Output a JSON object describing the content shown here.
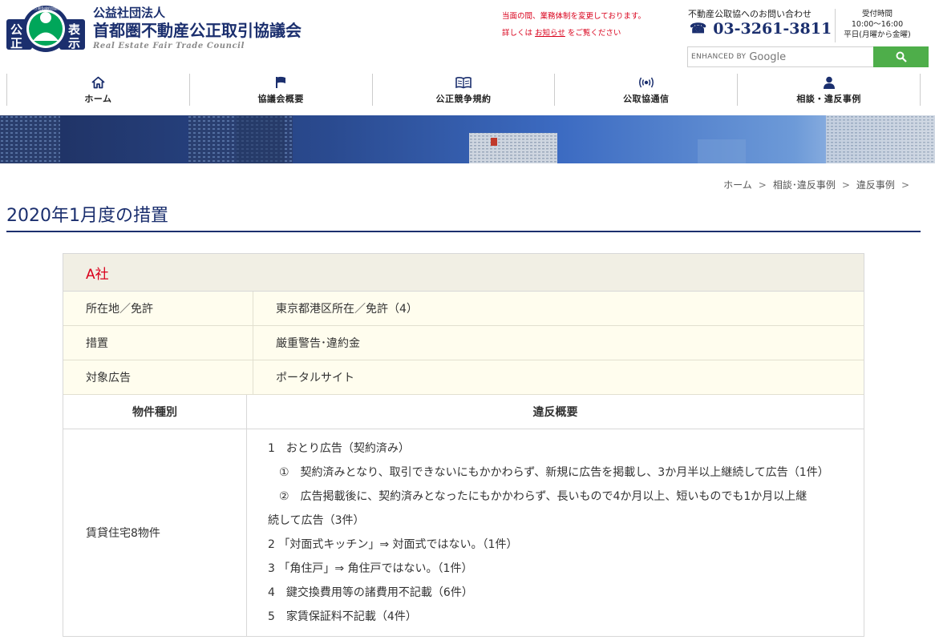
{
  "header": {
    "logo_chars": [
      "公",
      "正",
      "表",
      "示"
    ],
    "logo_ring_text": "公正競争規約加盟店",
    "org_type": "公益社団法人",
    "org_name": "首都圏不動産公正取引協議会",
    "org_name_en": "Real Estate Fair Trade Council",
    "notice_line1": "当面の間、業務体制を変更しております。",
    "notice_prefix": "詳しくは",
    "notice_link": "お知らせ",
    "notice_suffix": "をご覧ください",
    "contact_label": "不動産公取協へのお問い合わせ",
    "phone": "03-3261-3811",
    "hours_title": "受付時間",
    "hours_time": "10:00〜16:00",
    "hours_days": "平日(月曜から金曜)",
    "search": {
      "enhanced_by": "ENHANCED BY",
      "google": "Google",
      "button_icon": "search-icon"
    }
  },
  "nav": {
    "items": [
      {
        "label": "ホーム",
        "icon": "home-icon"
      },
      {
        "label": "協議会概要",
        "icon": "flag-icon"
      },
      {
        "label": "公正競争規約",
        "icon": "book-icon"
      },
      {
        "label": "公取協通信",
        "icon": "broadcast-icon"
      },
      {
        "label": "相談・違反事例",
        "icon": "person-icon"
      }
    ]
  },
  "breadcrumb": [
    "ホーム",
    "相談･違反事例",
    "違反事例"
  ],
  "page_title": "2020年1月度の措置",
  "case": {
    "company": "A社",
    "rows": [
      {
        "key": "所在地／免許",
        "value": "東京都港区所在／免許（4）"
      },
      {
        "key": "措置",
        "value": "厳重警告･違約金"
      },
      {
        "key": "対象広告",
        "value": "ポータルサイト"
      }
    ],
    "col_property": "物件種別",
    "col_summary": "違反概要",
    "property_type": "賃貸住宅8物件",
    "violations": [
      "1　おとり広告（契約済み）",
      "　①　契約済みとなり、取引できないにもかかわらず、新規に広告を掲載し、3か月半以上継続して広告（1件）",
      "　②　広告掲載後に、契約済みとなったにもかかわらず、長いもので4か月以上、短いものでも1か月以上継",
      "続して広告（3件）",
      "2 「対面式キッチン」⇒ 対面式ではない。（1件）",
      "3 「角住戸」⇒ 角住戸ではない。（1件）",
      "4　鍵交換費用等の諸費用不記載（6件）",
      "5　家賃保証料不記載（4件）"
    ]
  },
  "colors": {
    "brand_navy": "#1b2f6e",
    "logo_green": "#00a65a",
    "notice_red": "#d9001b",
    "search_green": "#4eae4a",
    "row_cream": "#fffdee",
    "head_beige": "#f1efe4"
  }
}
